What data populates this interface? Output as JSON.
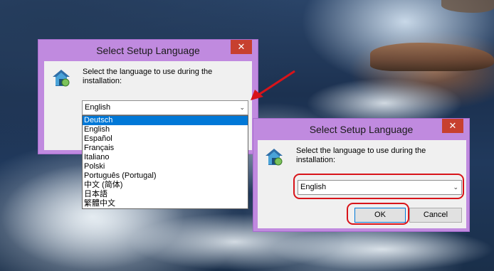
{
  "dialog_back": {
    "title": "Select Setup Language",
    "close_glyph": "✕",
    "prompt_line1": "Select the language to use during the",
    "prompt_line2": "installation:",
    "selected_language": "English",
    "dropdown_arrow": "⌄",
    "options": [
      {
        "label": "Deutsch",
        "highlighted": true
      },
      {
        "label": "English",
        "highlighted": false
      },
      {
        "label": "Español",
        "highlighted": false
      },
      {
        "label": "Français",
        "highlighted": false
      },
      {
        "label": "Italiano",
        "highlighted": false
      },
      {
        "label": "Polski",
        "highlighted": false
      },
      {
        "label": "Português (Portugal)",
        "highlighted": false
      },
      {
        "label": "中文 (简体)",
        "highlighted": false
      },
      {
        "label": "日本語",
        "highlighted": false
      },
      {
        "label": "繁體中文",
        "highlighted": false
      }
    ]
  },
  "dialog_front": {
    "title": "Select Setup Language",
    "close_glyph": "✕",
    "prompt_line1": "Select the language to use during the",
    "prompt_line2": "installation:",
    "selected_language": "English",
    "dropdown_arrow": "⌄",
    "ok_label": "OK",
    "cancel_label": "Cancel"
  },
  "icons": {
    "app": "setup-app-icon",
    "annotation": "red-arrow"
  },
  "colors": {
    "title_bar": "#c08adf",
    "close_button": "#c7402f",
    "selection": "#0078d7",
    "annotation": "#d8141a"
  }
}
